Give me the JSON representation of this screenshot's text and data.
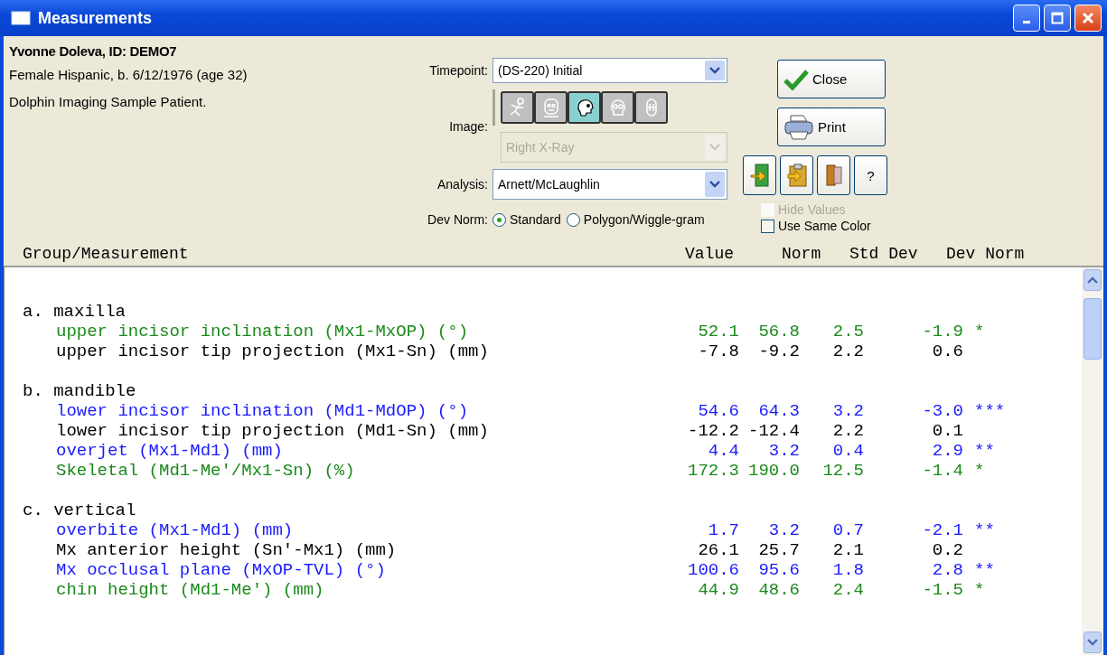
{
  "window": {
    "title": "Measurements"
  },
  "patient": {
    "name": "Yvonne Doleva,  ID: DEMO7",
    "details": "Female Hispanic, b. 6/12/1976 (age 32)",
    "note": "Dolphin Imaging Sample Patient."
  },
  "timepoint": {
    "label": "Timepoint:",
    "value": "(DS-220) Initial"
  },
  "image": {
    "label": "Image:",
    "types": [
      {
        "kind": "skeleton",
        "selected": false
      },
      {
        "kind": "face",
        "selected": false
      },
      {
        "kind": "profile",
        "selected": true
      },
      {
        "kind": "skull",
        "selected": false
      },
      {
        "kind": "teeth",
        "selected": false
      }
    ],
    "value": "Right X-Ray",
    "disabled": true
  },
  "analysis": {
    "label": "Analysis:",
    "value": "Arnett/McLaughlin"
  },
  "dev_norm": {
    "label": "Dev Norm:",
    "options": [
      {
        "label": "Standard",
        "selected": true
      },
      {
        "label": "Polygon/Wiggle-gram",
        "selected": false
      }
    ]
  },
  "buttons": [
    {
      "kind": "close",
      "label": "Close"
    },
    {
      "kind": "print",
      "label": "Print"
    }
  ],
  "tools": [
    {
      "kind": "export"
    },
    {
      "kind": "paste"
    },
    {
      "kind": "book"
    },
    {
      "kind": "help",
      "label": "?"
    }
  ],
  "options": [
    {
      "label": "Hide Values",
      "checked": false,
      "disabled": true
    },
    {
      "label": "Use Same Color",
      "checked": false,
      "disabled": false
    }
  ],
  "columns": [
    "Group/Measurement",
    "Value",
    "Norm",
    "Std Dev",
    "Dev Norm"
  ],
  "groups": [
    {
      "label": "a. maxilla",
      "rows": [
        {
          "name": "upper incisor inclination (Mx1-MxOP) (°)",
          "value": "52.1",
          "norm": "56.8",
          "std_dev": "2.5",
          "dev_norm": "-1.9",
          "flag": "*",
          "color": "#1a8a1a"
        },
        {
          "name": "upper incisor tip projection (Mx1-Sn) (mm)",
          "value": "-7.8",
          "norm": "-9.2",
          "std_dev": "2.2",
          "dev_norm": "0.6",
          "color": "#000000"
        }
      ]
    },
    {
      "label": "b. mandible",
      "rows": [
        {
          "name": "lower incisor inclination (Md1-MdOP) (°)",
          "value": "54.6",
          "norm": "64.3",
          "std_dev": "3.2",
          "dev_norm": "-3.0",
          "flag": "***",
          "color": "#1a1aff"
        },
        {
          "name": "lower incisor tip projection (Md1-Sn) (mm)",
          "value": "-12.2",
          "norm": "-12.4",
          "std_dev": "2.2",
          "dev_norm": "0.1",
          "color": "#000000"
        },
        {
          "name": "overjet (Mx1-Md1) (mm)",
          "value": "4.4",
          "norm": "3.2",
          "std_dev": "0.4",
          "dev_norm": "2.9",
          "flag": "**",
          "color": "#1a1aff"
        },
        {
          "name": "Skeletal (Md1-Me'/Mx1-Sn) (%)",
          "value": "172.3",
          "norm": "190.0",
          "std_dev": "12.5",
          "dev_norm": "-1.4",
          "flag": "*",
          "color": "#1a8a1a"
        }
      ]
    },
    {
      "label": "c. vertical",
      "rows": [
        {
          "name": "overbite (Mx1-Md1) (mm)",
          "value": "1.7",
          "norm": "3.2",
          "std_dev": "0.7",
          "dev_norm": "-2.1",
          "flag": "**",
          "color": "#1a1aff"
        },
        {
          "name": "Mx anterior height (Sn'-Mx1) (mm)",
          "value": "26.1",
          "norm": "25.7",
          "std_dev": "2.1",
          "dev_norm": "0.2",
          "color": "#000000"
        },
        {
          "name": "Mx occlusal plane (MxOP-TVL) (°)",
          "value": "100.6",
          "norm": "95.6",
          "std_dev": "1.8",
          "dev_norm": "2.8",
          "flag": "**",
          "color": "#1a1aff"
        },
        {
          "name": "chin height (Md1-Me') (mm)",
          "value": "44.9",
          "norm": "48.6",
          "std_dev": "2.4",
          "dev_norm": "-1.5",
          "flag": "*",
          "color": "#1a8a1a"
        }
      ]
    }
  ]
}
